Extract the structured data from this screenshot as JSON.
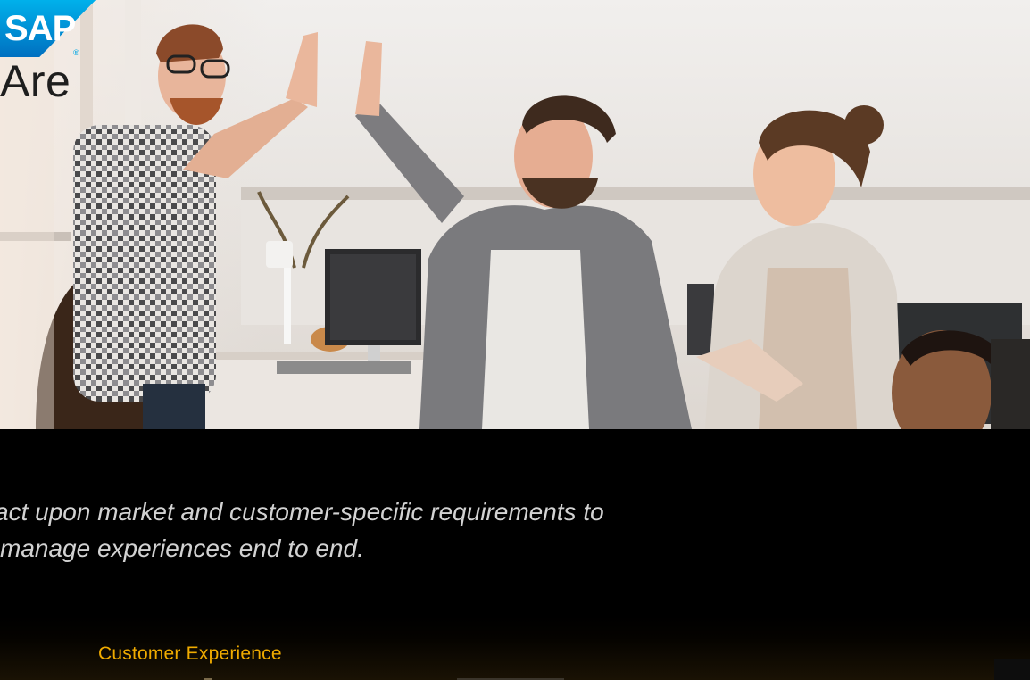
{
  "hero": {
    "title": "Are",
    "image_description_icon": "team-high-five-photo"
  },
  "logo": {
    "text": "SAP",
    "registered": "®",
    "colors": {
      "top": "#00a7e5",
      "bottom": "#0068b3"
    }
  },
  "tagline": {
    "line1": "act upon market and customer-specific requirements to",
    "line2": "manage experiences end to end."
  },
  "section": {
    "label": "Customer Experience",
    "accent_color": "#f0ab00"
  }
}
